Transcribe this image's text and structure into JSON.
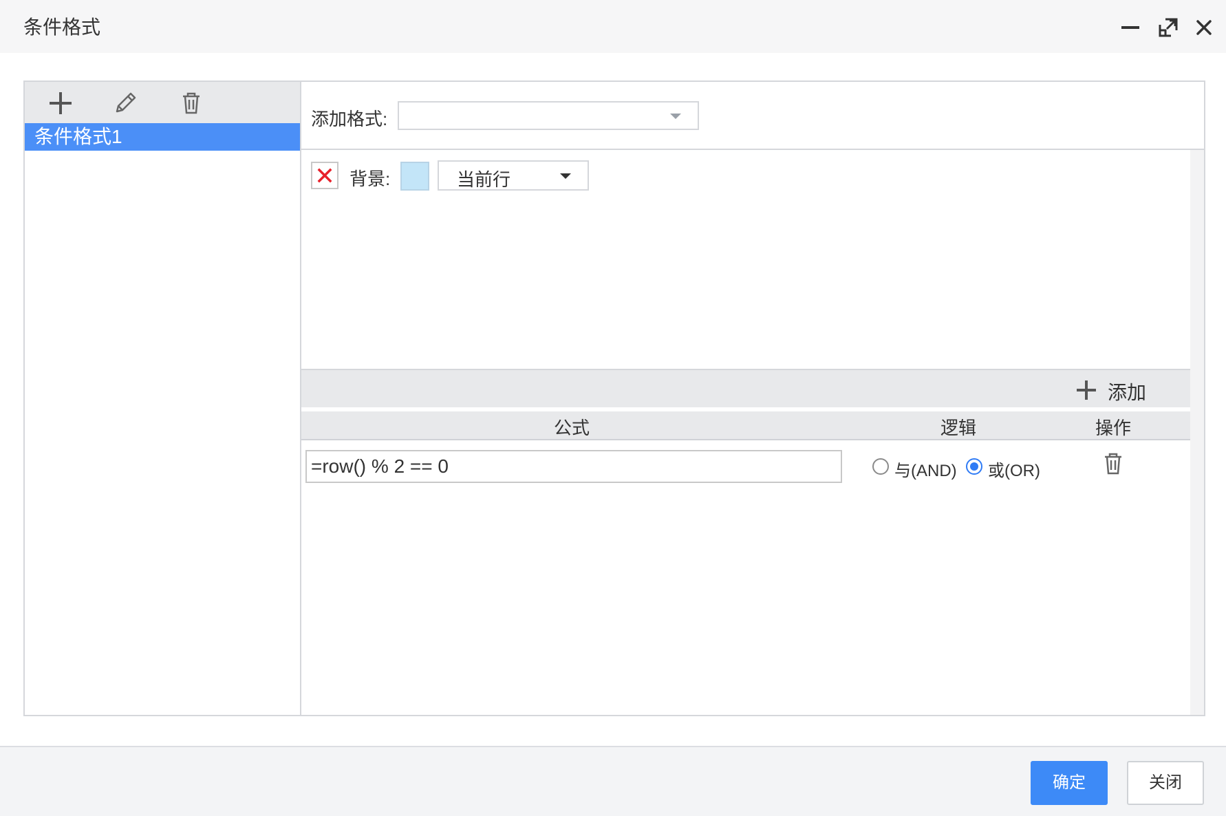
{
  "dialog": {
    "title": "条件格式",
    "window_buttons": [
      {
        "name": "minimize-icon"
      },
      {
        "name": "maximize-icon"
      },
      {
        "name": "close-icon"
      }
    ]
  },
  "left_panel": {
    "toolbar": [
      {
        "icon": "plus-icon",
        "action": "add"
      },
      {
        "icon": "pencil-icon",
        "action": "edit"
      },
      {
        "icon": "trash-icon",
        "action": "delete"
      }
    ],
    "items": [
      {
        "label": "条件格式1",
        "selected": true
      }
    ]
  },
  "right_panel": {
    "add_format_label": "添加格式:",
    "add_format_value": "",
    "format": {
      "delete_icon": "x-icon",
      "background_label": "背景:",
      "background_color": "#c3e5f8",
      "scope_value": "当前行"
    },
    "conditions": {
      "add_label": "添加",
      "columns": {
        "formula": "公式",
        "logic": "逻辑",
        "operation": "操作"
      },
      "rows": [
        {
          "formula": "=row() % 2 == 0",
          "logic_and": "与(AND)",
          "logic_or": "或(OR)",
          "selected_logic": "OR"
        }
      ]
    }
  },
  "footer": {
    "confirm_label": "确定",
    "close_label": "关闭"
  },
  "colors": {
    "accent": "#3d8af7",
    "selection": "#4b8ff7",
    "delete_x": "#e8202a"
  }
}
